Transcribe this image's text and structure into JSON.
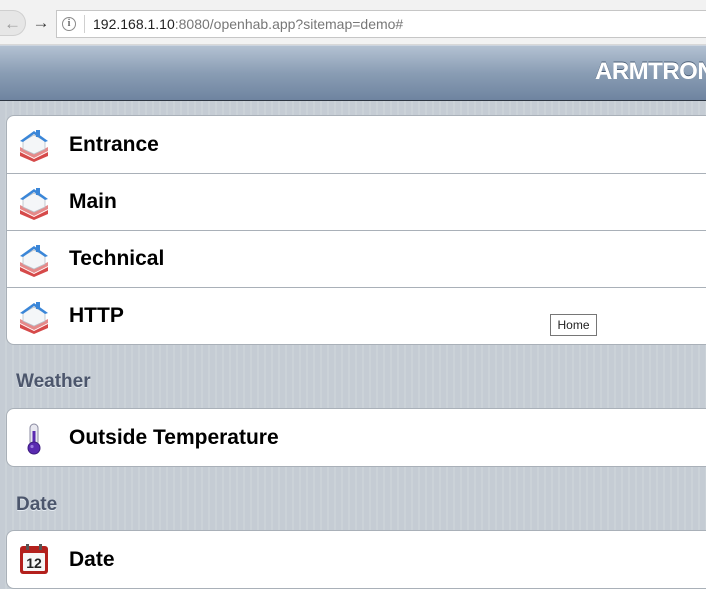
{
  "browser": {
    "url_host": "192.168.1.10",
    "url_rest": ":8080/openhab.app?sitemap=demo#",
    "back_icon": "arrow-left-icon",
    "forward_icon": "arrow-right-icon",
    "info_icon": "info-icon"
  },
  "header": {
    "title": "ARMTRONIX"
  },
  "home_group": {
    "items": [
      {
        "label": "Entrance",
        "icon": "house-icon"
      },
      {
        "label": "Main",
        "icon": "house-icon"
      },
      {
        "label": "Technical",
        "icon": "house-icon"
      },
      {
        "label": "HTTP",
        "icon": "house-icon"
      }
    ]
  },
  "weather": {
    "title": "Weather",
    "items": [
      {
        "label": "Outside Temperature",
        "icon": "thermometer-icon"
      }
    ]
  },
  "date": {
    "title": "Date",
    "items": [
      {
        "label": "Date",
        "icon": "calendar-icon",
        "calendar_day": "12"
      }
    ]
  },
  "tooltip": {
    "text": "Home"
  }
}
